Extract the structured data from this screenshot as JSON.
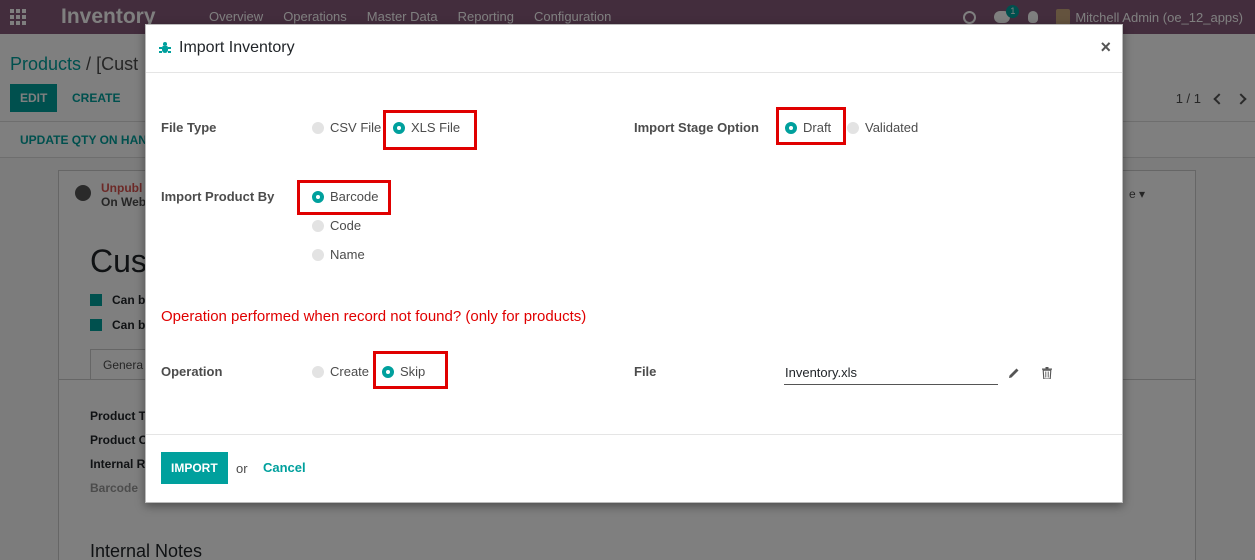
{
  "topbar": {
    "app_name": "Inventory",
    "menu": [
      "Overview",
      "Operations",
      "Master Data",
      "Reporting",
      "Configuration"
    ],
    "chat_badge": "1",
    "user": "Mitchell Admin (oe_12_apps)"
  },
  "control_panel": {
    "breadcrumb_root": "Products",
    "breadcrumb_sep": " / ",
    "breadcrumb_current": "[Cust",
    "edit_label": "EDIT",
    "create_label": "CREATE",
    "pager": "1 / 1"
  },
  "action_bar": {
    "update_qty_label": "UPDATE QTY ON HAN"
  },
  "sheet": {
    "publish_status": "Unpubl",
    "publish_sub": "On Web",
    "title": "Cust",
    "check_1": "Can b",
    "check_2": "Can b",
    "tab_general": "Genera",
    "fields": [
      "Product T",
      "Product C",
      "Internal R",
      "Barcode"
    ],
    "internal_notes": "Internal Notes",
    "right_dropdown": "e"
  },
  "modal": {
    "title": "Import Inventory",
    "close": "×",
    "file_type": {
      "label": "File Type",
      "options": [
        {
          "label": "CSV File",
          "selected": false
        },
        {
          "label": "XLS File",
          "selected": true
        }
      ]
    },
    "import_stage": {
      "label": "Import Stage Option",
      "options": [
        {
          "label": "Draft",
          "selected": true
        },
        {
          "label": "Validated",
          "selected": false
        }
      ]
    },
    "import_product_by": {
      "label": "Import Product By",
      "options": [
        {
          "label": "Barcode",
          "selected": true
        },
        {
          "label": "Code",
          "selected": false
        },
        {
          "label": "Name",
          "selected": false
        }
      ]
    },
    "warning": "Operation performed when record not found? (only for products)",
    "operation": {
      "label": "Operation",
      "options": [
        {
          "label": "Create",
          "selected": false
        },
        {
          "label": "Skip",
          "selected": true
        }
      ]
    },
    "file": {
      "label": "File",
      "value": "Inventory.xls"
    },
    "import_button": "IMPORT",
    "or_text": "or",
    "cancel_button": "Cancel"
  },
  "colors": {
    "brand": "#875a7b",
    "accent": "#00a09d",
    "highlight": "#e00000"
  }
}
